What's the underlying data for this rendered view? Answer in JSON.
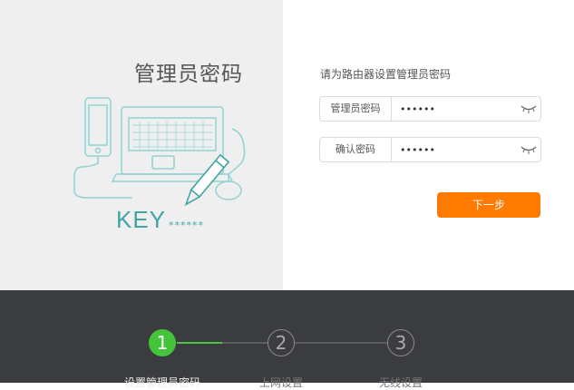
{
  "left_panel": {
    "title": "管理员密码",
    "illustration": {
      "key_text": "KEY",
      "key_stars": "******"
    }
  },
  "form": {
    "prompt": "请为路由器设置管理员密码",
    "fields": [
      {
        "label": "管理员密码",
        "value": "••••••"
      },
      {
        "label": "确认密码",
        "value": "••••••"
      }
    ],
    "next_label": "下一步"
  },
  "steps": [
    {
      "number": "1",
      "label": "设置管理员密码"
    },
    {
      "number": "2",
      "label": "上网设置"
    },
    {
      "number": "3",
      "label": "无线设置"
    }
  ],
  "colors": {
    "accent": "#ff7a00",
    "step_active": "#44c43a",
    "footer_bg": "#3b3c3f",
    "illustration": "#3fa6a4"
  }
}
